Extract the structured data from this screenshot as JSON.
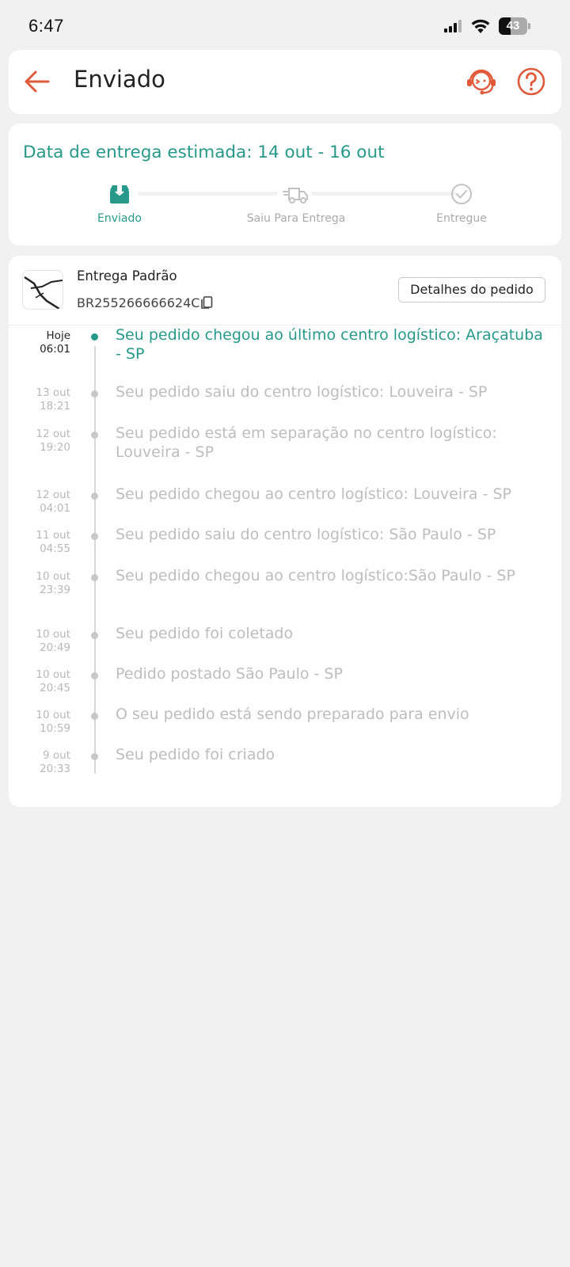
{
  "status_bar": {
    "time": "6:47",
    "battery": "43",
    "battery_level": 0.43,
    "icons": [
      "signal-icon",
      "wifi-icon",
      "battery-icon"
    ]
  },
  "header": {
    "title": "Enviado",
    "back_icon": "arrow-left-icon",
    "support_icon": "headset-support-icon",
    "help_icon": "question-circle-icon"
  },
  "estimate": {
    "title": "Data de entrega estimada: 14 out - 16 out",
    "steps": [
      {
        "label": "Enviado",
        "icon": "package-icon",
        "active": true
      },
      {
        "label": "Saiu Para Entrega",
        "icon": "truck-icon",
        "active": false
      },
      {
        "label": "Entregue",
        "icon": "check-circle-icon",
        "active": false
      }
    ]
  },
  "shipment": {
    "carrier": "Entrega Padrão",
    "tracking_code": "BR255266666624C",
    "details_button": "Detalhes do pedido"
  },
  "events": [
    {
      "date": "Hoje",
      "time": "06:01",
      "text": "Seu pedido chegou ao último centro logístico: Araçatuba - SP",
      "current": true
    },
    {
      "date": "13 out",
      "time": "18:21",
      "text": "Seu pedido saiu do centro logístico: Louveira - SP",
      "current": false
    },
    {
      "date": "12 out",
      "time": "19:20",
      "text": "Seu pedido está em separação no centro logístico: Louveira - SP",
      "current": false
    },
    {
      "date": "12 out",
      "time": "04:01",
      "text": "Seu pedido chegou ao centro logístico: Louveira - SP",
      "current": false
    },
    {
      "date": "11 out",
      "time": "04:55",
      "text": "Seu pedido saiu do centro logístico: São Paulo - SP",
      "current": false
    },
    {
      "date": "10 out",
      "time": "23:39",
      "text": "Seu pedido chegou ao centro logístico:São Paulo - SP",
      "current": false
    },
    {
      "date": "10 out",
      "time": "20:49",
      "text": "Seu pedido foi coletado",
      "current": false
    },
    {
      "date": "10 out",
      "time": "20:45",
      "text": "Pedido postado São Paulo - SP",
      "current": false
    },
    {
      "date": "10 out",
      "time": "10:59",
      "text": "O seu pedido está sendo preparado para envio",
      "current": false
    },
    {
      "date": "9 out",
      "time": "20:33",
      "text": "Seu pedido foi criado",
      "current": false
    }
  ],
  "colors": {
    "accent": "#26998a",
    "brand": "#e05a3a",
    "muted": "#bdbdbd"
  }
}
